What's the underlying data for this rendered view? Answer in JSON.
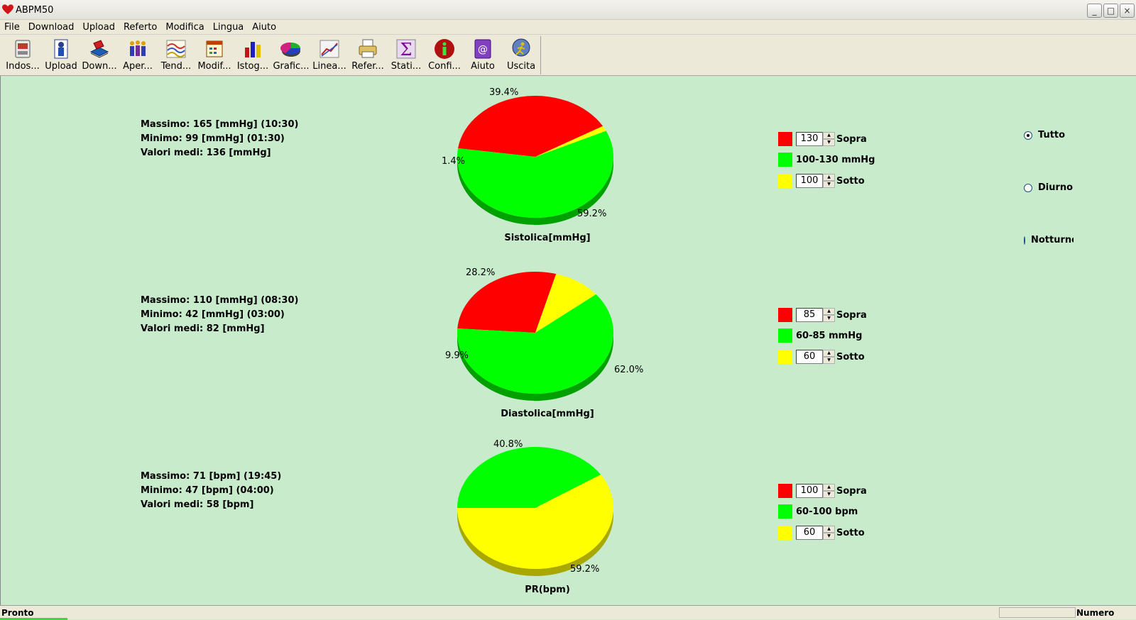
{
  "window": {
    "title": "ABPM50",
    "minimize": "_",
    "maximize": "□",
    "close": "×"
  },
  "menu": [
    "File",
    "Download",
    "Upload",
    "Referto",
    "Modifica",
    "Lingua",
    "Aiuto"
  ],
  "toolbar": [
    {
      "label": "Indos...",
      "icon": "device-icon"
    },
    {
      "label": "Upload",
      "icon": "person-upload-icon"
    },
    {
      "label": "Down...",
      "icon": "download-book-icon"
    },
    {
      "label": "Aper...",
      "icon": "group-people-icon"
    },
    {
      "label": "Tend...",
      "icon": "trend-wave-icon"
    },
    {
      "label": "Modif...",
      "icon": "calendar-edit-icon"
    },
    {
      "label": "Istog...",
      "icon": "histogram-icon"
    },
    {
      "label": "Grafic...",
      "icon": "pie-chart-icon"
    },
    {
      "label": "Linea...",
      "icon": "line-chart-icon"
    },
    {
      "label": "Refer...",
      "icon": "printer-icon"
    },
    {
      "label": "Stati...",
      "icon": "sigma-icon"
    },
    {
      "label": "Confi...",
      "icon": "info-icon"
    },
    {
      "label": "Aiuto",
      "icon": "help-book-icon"
    },
    {
      "label": "Uscita",
      "icon": "exit-runner-icon"
    }
  ],
  "colors": {
    "red": "#ff0000",
    "green": "#00ff00",
    "yellow": "#ffff00",
    "background": "#c8ebcc"
  },
  "panels": [
    {
      "stats": [
        "Massimo: 165 [mmHg] (10:30)",
        "Minimo: 99 [mmHg] (01:30)",
        "Valori medi: 136 [mmHg]"
      ],
      "title": "Sistolica[mmHg]",
      "slices": [
        {
          "color": "red",
          "value": 39.4,
          "label": "39.4%"
        },
        {
          "color": "yellow",
          "value": 1.4,
          "label": "1.4%"
        },
        {
          "color": "green",
          "value": 59.2,
          "label": "59.2%"
        }
      ],
      "legend": {
        "upper": "130",
        "upper_label": "Sopra",
        "range_label": "100-130 mmHg",
        "lower": "100",
        "lower_label": "Sotto"
      }
    },
    {
      "stats": [
        "Massimo: 110 [mmHg] (08:30)",
        "Minimo: 42 [mmHg] (03:00)",
        "Valori medi: 82 [mmHg]"
      ],
      "title": "Diastolica[mmHg]",
      "slices": [
        {
          "color": "red",
          "value": 28.2,
          "label": "28.2%"
        },
        {
          "color": "yellow",
          "value": 9.9,
          "label": "9.9%"
        },
        {
          "color": "green",
          "value": 62.0,
          "label": "62.0%"
        }
      ],
      "legend": {
        "upper": "85",
        "upper_label": "Sopra",
        "range_label": "60-85 mmHg",
        "lower": "60",
        "lower_label": "Sotto"
      }
    },
    {
      "stats": [
        "Massimo: 71 [bpm] (19:45)",
        "Minimo: 47 [bpm] (04:00)",
        "Valori medi: 58 [bpm]"
      ],
      "title": "PR(bpm)",
      "slices": [
        {
          "color": "green",
          "value": 40.8,
          "label": "40.8%"
        },
        {
          "color": "yellow",
          "value": 59.2,
          "label": "59.2%"
        }
      ],
      "legend": {
        "upper": "100",
        "upper_label": "Sopra",
        "range_label": "60-100 bpm",
        "lower": "60",
        "lower_label": "Sotto"
      }
    }
  ],
  "period": {
    "options": [
      "Tutto",
      "Diurno",
      "Notturno"
    ],
    "selected": "Tutto"
  },
  "status": {
    "left": "Pronto",
    "right": "Numero"
  }
}
